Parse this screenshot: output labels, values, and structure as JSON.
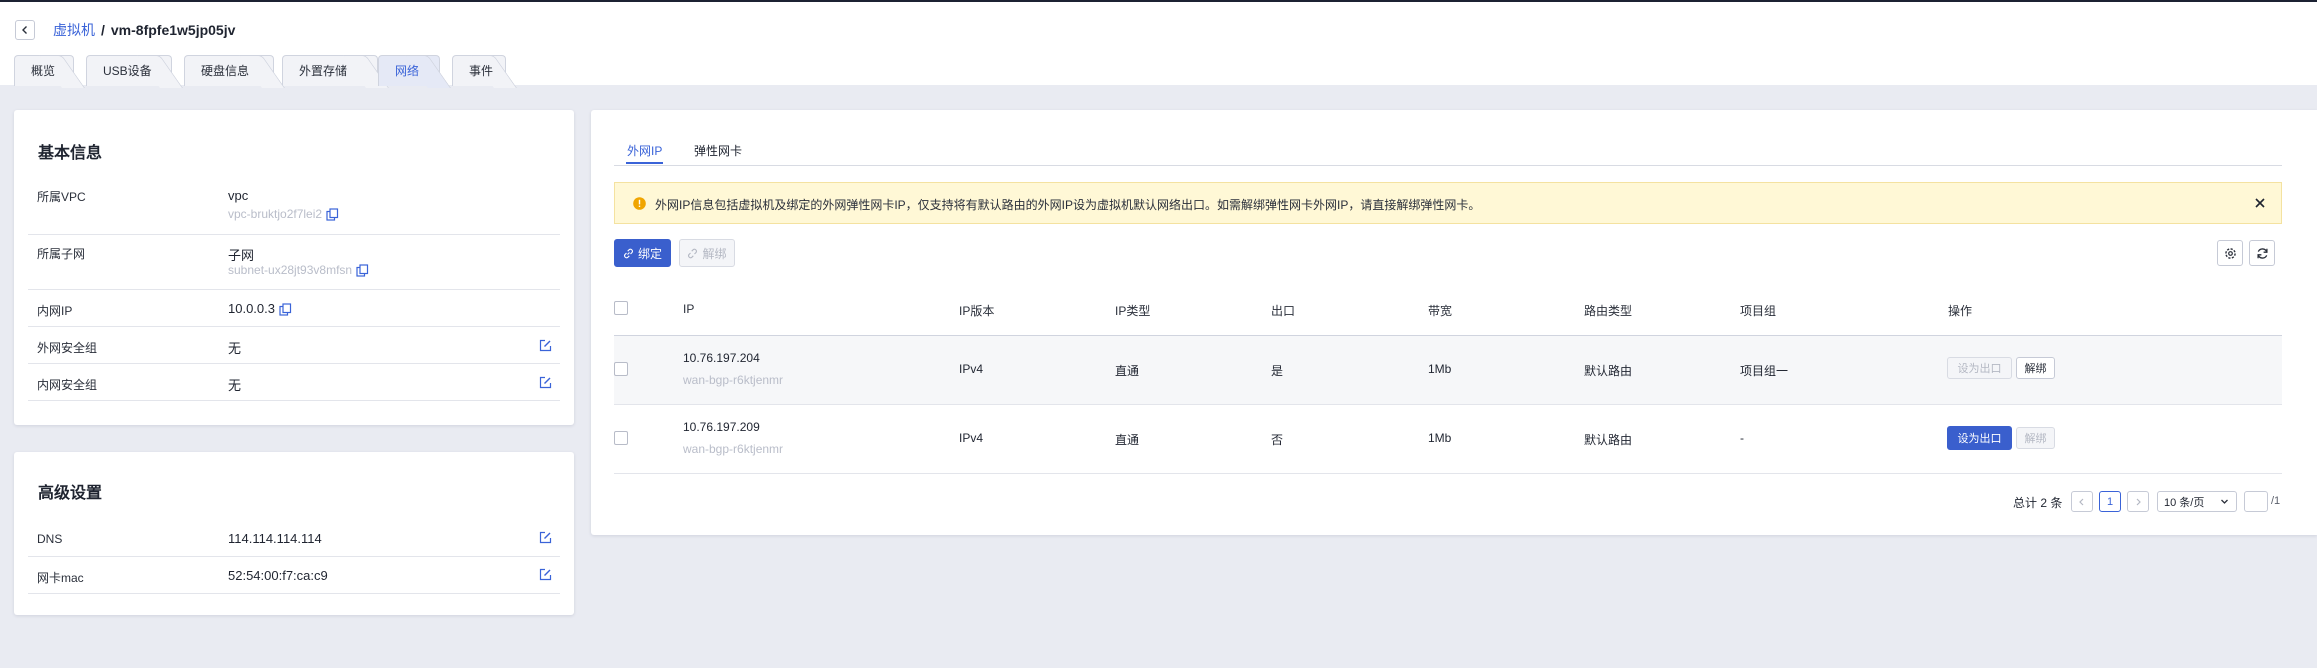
{
  "breadcrumb": {
    "parent": "虚拟机",
    "separator": "/",
    "current": "vm-8fpfe1w5jp05jv"
  },
  "tabs": [
    "概览",
    "USB设备",
    "硬盘信息",
    "外置存储",
    "网络",
    "事件"
  ],
  "active_tab": "网络",
  "basic_info": {
    "title": "基本信息",
    "rows": [
      {
        "label": "所属VPC",
        "value": "vpc",
        "sub": "vpc-bruktjo2f7lei2"
      },
      {
        "label": "所属子网",
        "value": "子网",
        "sub": "subnet-ux28jt93v8mfsn"
      },
      {
        "label": "内网IP",
        "value": "10.0.0.3"
      },
      {
        "label": "外网安全组",
        "value": "无"
      },
      {
        "label": "内网安全组",
        "value": "无"
      }
    ]
  },
  "advanced": {
    "title": "高级设置",
    "rows": [
      {
        "label": "DNS",
        "value": "114.114.114.114"
      },
      {
        "label": "网卡mac",
        "value": "52:54:00:f7:ca:c9"
      }
    ]
  },
  "network": {
    "tabs": [
      "外网IP",
      "弹性网卡"
    ],
    "active_tab": "外网IP",
    "alert": "外网IP信息包括虚拟机及绑定的外网弹性网卡IP，仅支持将有默认路由的外网IP设为虚拟机默认网络出口。如需解绑弹性网卡外网IP，请直接解绑弹性网卡。",
    "bind_label": "绑定",
    "unbind_label": "解绑",
    "columns": [
      "IP",
      "IP版本",
      "IP类型",
      "出口",
      "带宽",
      "路由类型",
      "项目组",
      "操作"
    ],
    "rows": [
      {
        "ip": "10.76.197.204",
        "sub": "wan-bgp-r6ktjenmr",
        "version": "IPv4",
        "type": "直通",
        "egress": "是",
        "bandwidth": "1Mb",
        "route": "默认路由",
        "group": "项目组一",
        "action_set": "设为出口",
        "action_unbind": "解绑"
      },
      {
        "ip": "10.76.197.209",
        "sub": "wan-bgp-r6ktjenmr",
        "version": "IPv4",
        "type": "直通",
        "egress": "否",
        "bandwidth": "1Mb",
        "route": "默认路由",
        "group": "-",
        "action_set": "设为出口",
        "action_unbind": "解绑"
      }
    ],
    "pagination": {
      "total": "总计 2 条",
      "page": "1",
      "page_size": "10 条/页",
      "pages_suffix": "/1"
    }
  },
  "colors": {
    "accent": "#3a5fcd",
    "link": "#3a63d8",
    "alert_bg": "#fff8d6",
    "background": "#e9ebf2"
  }
}
